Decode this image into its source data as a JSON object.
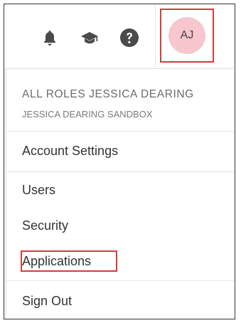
{
  "header": {
    "icons": [
      "bell-icon",
      "graduation-cap-icon",
      "help-circle-icon"
    ],
    "avatar_initials": "AJ",
    "avatar_color": "#f7c6cf",
    "highlight_color": "#d63c3c"
  },
  "menu": {
    "role_name": "ALL ROLES JESSICA DEARING",
    "account_name": "JESSICA DEARING SANDBOX",
    "items": [
      {
        "label": "Account Settings"
      },
      {
        "label": "Users"
      },
      {
        "label": "Security"
      },
      {
        "label": "Applications"
      },
      {
        "label": "Sign Out"
      }
    ]
  }
}
